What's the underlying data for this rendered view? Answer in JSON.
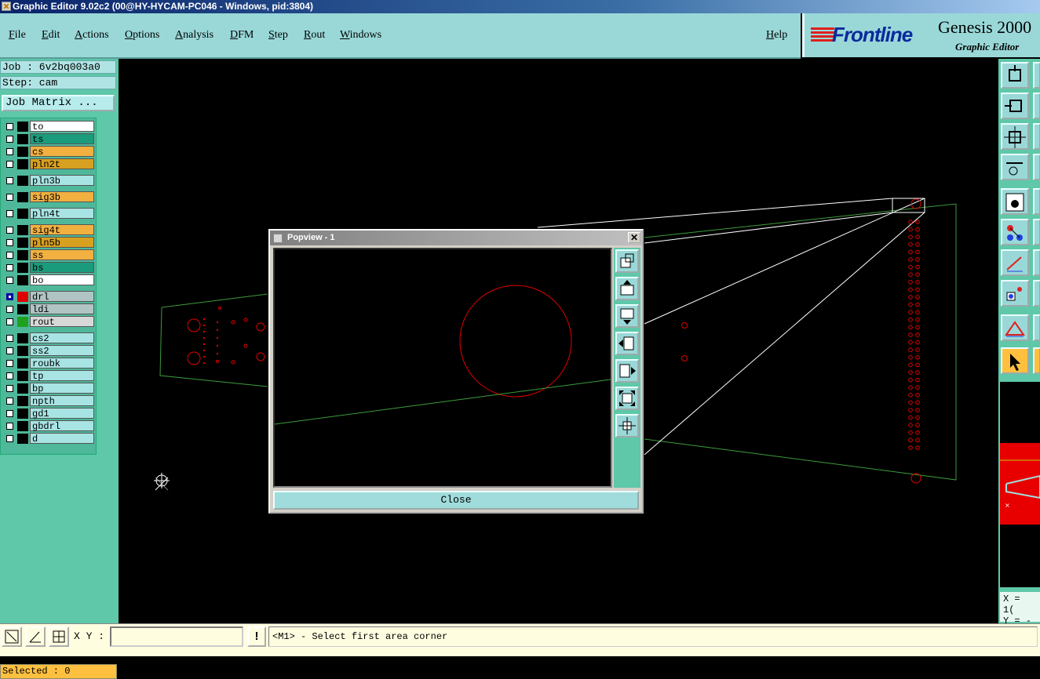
{
  "window": {
    "title": "Graphic Editor 9.02c2 (00@HY-HYCAM-PC046 - Windows, pid:3804)"
  },
  "menu": {
    "items": [
      "File",
      "Edit",
      "Actions",
      "Options",
      "Analysis",
      "DFM",
      "Step",
      "Rout",
      "Windows"
    ],
    "help": "Help"
  },
  "logo": {
    "brand": "Frontline",
    "product": "Genesis 2000",
    "subtitle": "Graphic Editor"
  },
  "job": {
    "job_line": "Job : 6v2bq003a0",
    "step_line": "Step: cam",
    "matrix_button": "Job Matrix ..."
  },
  "layers": [
    {
      "name": "to",
      "color": "#ffffff",
      "swatch": "#000000"
    },
    {
      "name": "ts",
      "color": "#1a9c7c",
      "swatch": "#000000"
    },
    {
      "name": "cs",
      "color": "#f2b040",
      "swatch": "#000000"
    },
    {
      "name": "pln2t",
      "color": "#d8a020",
      "swatch": "#000000"
    },
    {
      "name": "pln3b",
      "color": "#a8e4e4",
      "swatch": "#000000"
    },
    {
      "name": "sig3b",
      "color": "#f2b040",
      "swatch": "#000000"
    },
    {
      "name": "pln4t",
      "color": "#a8e4e4",
      "swatch": "#000000"
    },
    {
      "name": "sig4t",
      "color": "#f2b040",
      "swatch": "#000000"
    },
    {
      "name": "pln5b",
      "color": "#d8a020",
      "swatch": "#000000"
    },
    {
      "name": "ss",
      "color": "#f2b040",
      "swatch": "#000000"
    },
    {
      "name": "bs",
      "color": "#1a9c7c",
      "swatch": "#000000"
    },
    {
      "name": "bo",
      "color": "#ffffff",
      "swatch": "#000000"
    },
    {
      "name": "drl",
      "color": "#b0c4c4",
      "swatch": "#e00000"
    },
    {
      "name": "ldi",
      "color": "#b0c4c4",
      "swatch": "#000000"
    },
    {
      "name": "rout",
      "color": "#d8d8d8",
      "swatch": "#20a020"
    },
    {
      "name": "cs2",
      "color": "#a8e4e4",
      "swatch": "#000000"
    },
    {
      "name": "ss2",
      "color": "#a8e4e4",
      "swatch": "#000000"
    },
    {
      "name": "roubk",
      "color": "#a8e4e4",
      "swatch": "#000000"
    },
    {
      "name": "tp",
      "color": "#a8e4e4",
      "swatch": "#000000"
    },
    {
      "name": "bp",
      "color": "#a8e4e4",
      "swatch": "#000000"
    },
    {
      "name": "npth",
      "color": "#a8e4e4",
      "swatch": "#000000"
    },
    {
      "name": "gd1",
      "color": "#a8e4e4",
      "swatch": "#000000"
    },
    {
      "name": "gbdrl",
      "color": "#a8e4e4",
      "swatch": "#000000"
    },
    {
      "name": "d",
      "color": "#a8e4e4",
      "swatch": "#000000"
    }
  ],
  "selected": "Selected : 0",
  "coords": {
    "x": "X = 1(",
    "y": "Y = -"
  },
  "statusbar": {
    "xy_label": "X Y :",
    "xy_value": "",
    "prompt": "<M1> - Select first area corner",
    "alert_glyph": "!"
  },
  "popview": {
    "title": "Popview - 1",
    "close": "Close",
    "close_glyph": "✕"
  },
  "colors": {
    "panel": "#5ec8a8",
    "menubar": "#9ad8d8",
    "feature_red": "#e00000",
    "profile_green": "#3c9c3c"
  },
  "icons": {
    "right_toolbar": [
      "pan-icon",
      "zoom-home-icon",
      "fit-icon",
      "measure-icon",
      "snap-icon",
      "connect-icon",
      "line-icon",
      "point-icon",
      "angle-icon",
      "select-arrow-icon"
    ],
    "popview_toolbar": [
      "zoom-window-icon",
      "pan-up-icon",
      "pan-down-icon",
      "pan-left-icon",
      "pan-right-icon",
      "zoom-in-icon",
      "zoom-fit-icon"
    ],
    "status": [
      "resize-icon",
      "angle-tool-icon",
      "grid-icon",
      "alert-icon"
    ]
  }
}
